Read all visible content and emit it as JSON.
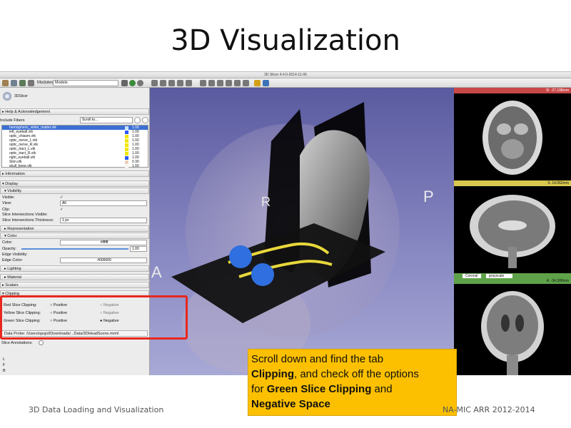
{
  "slide": {
    "title": "3D Visualization",
    "footer_left": "3D Data Loading and Visualization",
    "footer_right": "NA-MIC ARR 2012-2014"
  },
  "app": {
    "window_title": "3D Slicer 4.4.0-2014-11-06",
    "toolbar": {
      "modules_label": "Modules:",
      "module_value": "Models"
    },
    "logo_text": "3DSlicer",
    "sections": {
      "help": "Help & Acknowledgement",
      "include_fibers": "Include Fibers",
      "scroll_to": "Scroll to...",
      "information": "Information",
      "display": "Display",
      "visibility": "Visibility",
      "visible_label": "Visible:",
      "view_label": "View:",
      "view_value": "All",
      "clip_label": "Clip:",
      "slice_intersections_visible": "Slice Intersections Visible:",
      "slice_intersections_thickness": "Slice Intersections Thickness:",
      "thickness_value": "1 px",
      "representation": "Representation",
      "color": "Color",
      "color_label": "Color:",
      "color_value": "#ffffff",
      "opacity_label": "Opacity:",
      "opacity_value": "1.00",
      "edge_visibility": "Edge Visibility:",
      "edge_color": "Edge Color:",
      "edge_color_value": "#000000",
      "lighting": "Lighting",
      "material": "Material",
      "scalars": "Scalars",
      "clipping": "Clipping",
      "red_slice_clipping": "Red Slice Clipping:",
      "yellow_slice_clipping": "Yellow Slice Clipping:",
      "green_slice_clipping": "Green Slice Clipping:",
      "positive": "Positive",
      "negative": "Negative",
      "data_probe": "Data Probe: /Users/spujol/Downloads/...Data/3DHeadScene.mrml",
      "slice_annotations": "Slice Annotations:",
      "lfb": [
        "L",
        "F",
        "B"
      ]
    },
    "fibers": [
      {
        "name": "hemispheric_white_matter.vtk",
        "opacity": "1.00",
        "color": "#c8e0ff",
        "selected": true
      },
      {
        "name": "left_eyeball.vtk",
        "opacity": "1.00",
        "color": "#2a5cff"
      },
      {
        "name": "optic_chiasm.vtk",
        "opacity": "1.00",
        "color": "#f2e600"
      },
      {
        "name": "optic_nerve_L.vtk",
        "opacity": "1.00",
        "color": "#f2e600"
      },
      {
        "name": "optic_nerve_R.vtk",
        "opacity": "1.00",
        "color": "#f2e600"
      },
      {
        "name": "optic_tract_L.vtk",
        "opacity": "1.00",
        "color": "#f2e600"
      },
      {
        "name": "optic_tract_R.vtk",
        "opacity": "1.00",
        "color": "#f2e600"
      },
      {
        "name": "right_eyeball.vtk",
        "opacity": "1.00",
        "color": "#2a5cff"
      },
      {
        "name": "Skin.vtk",
        "opacity": "0.30",
        "color": "#f0d0b8"
      },
      {
        "name": "skull_bone.vtk",
        "opacity": "1.00",
        "color": "#f5f5f5"
      }
    ],
    "view3d": {
      "label_r": "R",
      "label_p": "P",
      "label_a": "A"
    },
    "slices": {
      "red_readout": "R: -27.198mm",
      "yellow_readout": "S: 14.062mm",
      "green_orientation": "Coronal",
      "green_volume": "grayscale",
      "green_readout": "A: -34.308mm"
    },
    "callout": {
      "line1": "Scroll down and find the tab",
      "clipping": "Clipping",
      "line2": ", and check off the options",
      "line3_pre": "for ",
      "green_slice_clipping": "Green Slice Clipping",
      "line3_post": " and",
      "negative_space": "Negative Space"
    }
  }
}
